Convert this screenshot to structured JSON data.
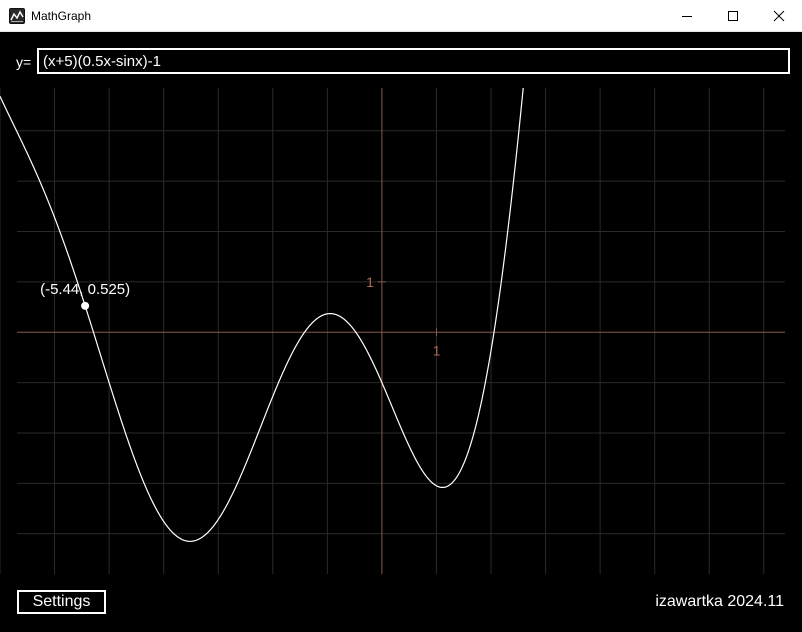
{
  "window": {
    "title": "MathGraph"
  },
  "formula": {
    "label": "y=",
    "value": "(x+5)(0.5x-sinx)-1"
  },
  "graph": {
    "cursor_readout": "(-5.44, 0.525)",
    "x_tick_label": "1",
    "y_tick_label": "1",
    "colors": {
      "curve": "#ffffff",
      "axis": "#8a5a48",
      "grid": "#2a2a2a",
      "tick_label": "#b06a52"
    }
  },
  "chart_data": {
    "type": "line",
    "function": "(x+5)(0.5x-sinx)-1",
    "xlim": [
      -7,
      7.7
    ],
    "ylim": [
      -4.8,
      4.85
    ],
    "grid": "on",
    "point": {
      "x": -5.44,
      "y": 0.525
    }
  },
  "footer": {
    "settings_label": "Settings",
    "credit": "izawartka 2024.11"
  }
}
